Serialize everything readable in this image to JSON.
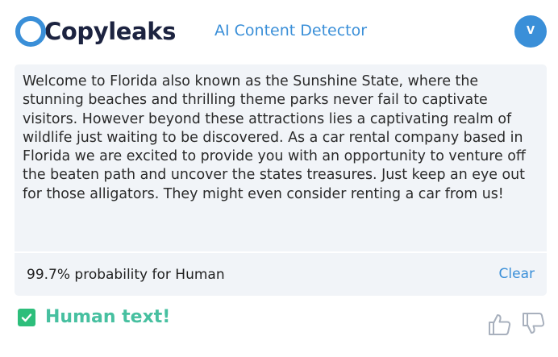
{
  "header": {
    "logo_text": "Copyleaks",
    "title": "AI Content Detector",
    "avatar_initial": "V"
  },
  "main": {
    "content_text": "Welcome to Florida also known as the Sunshine State, where the stunning beaches and thrilling theme parks never fail to captivate visitors. However beyond these attractions lies a captivating realm of wildlife just waiting to be discovered. As a car rental company based in Florida we are excited to provide you with an opportunity to venture off the beaten path and uncover the states treasures. Just keep an eye out for those alligators. They might even consider renting a car from us!",
    "result_label": "99.7% probability for Human",
    "clear_label": "Clear"
  },
  "verdict": {
    "text": "Human text!",
    "icon": "check-icon"
  },
  "feedback": {
    "up_icon": "thumbs-up-icon",
    "down_icon": "thumbs-down-icon"
  },
  "colors": {
    "brand_dark": "#1c2340",
    "accent_blue": "#3a8fd8",
    "human_green": "#2dbe7b",
    "verdict_text": "#47c0a0",
    "card_bg": "#f1f4f8"
  }
}
